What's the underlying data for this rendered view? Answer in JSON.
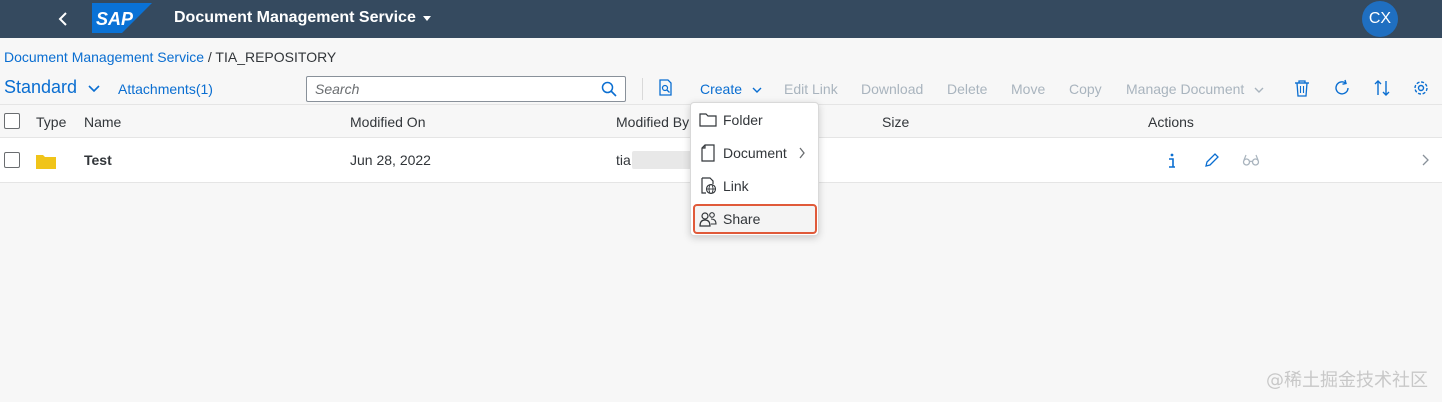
{
  "shell": {
    "logo_text": "SAP",
    "title": "Document Management Service",
    "avatar_initials": "CX",
    "colors": {
      "shellbar": "#354a5f",
      "avatar": "#1f6fc1",
      "logo": "#0a72d6"
    }
  },
  "breadcrumb": {
    "link": "Document Management Service",
    "separator": " / ",
    "current": "TIA_REPOSITORY"
  },
  "toolbar": {
    "variant": "Standard",
    "attachments": "Attachments(1)",
    "search_placeholder": "Search",
    "create": "Create",
    "edit_link": "Edit Link",
    "download": "Download",
    "delete": "Delete",
    "move": "Move",
    "copy": "Copy",
    "manage_document": "Manage Document",
    "icons": [
      "document-search-icon",
      "trash-icon",
      "refresh-icon",
      "sort-icon",
      "settings-icon"
    ]
  },
  "table": {
    "columns": {
      "type": "Type",
      "name": "Name",
      "modified_on": "Modified On",
      "modified_by": "Modified By",
      "size": "Size",
      "actions": "Actions"
    },
    "rows": [
      {
        "type_icon": "folder-icon",
        "name": "Test",
        "modified_on": "Jun 28, 2022",
        "modified_by": "tia",
        "size": ""
      }
    ],
    "action_icons": [
      "info-icon",
      "edit-icon",
      "preview-icon"
    ]
  },
  "create_menu": {
    "items": [
      {
        "label": "Folder",
        "icon": "folder-outline-icon"
      },
      {
        "label": "Document",
        "icon": "document-icon"
      },
      {
        "label": "Link",
        "icon": "link-icon"
      },
      {
        "label": "Share",
        "icon": "share-icon"
      }
    ],
    "highlight_color": "#e05a3a"
  },
  "watermark": "@稀土掘金技术社区"
}
